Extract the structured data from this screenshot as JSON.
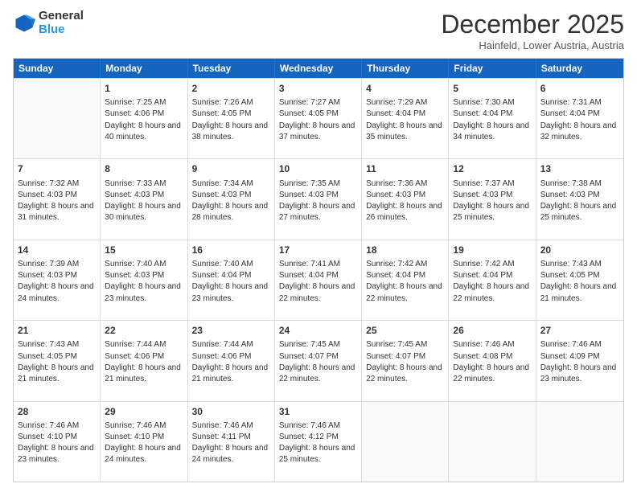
{
  "logo": {
    "general": "General",
    "blue": "Blue"
  },
  "header": {
    "month": "December 2025",
    "location": "Hainfeld, Lower Austria, Austria"
  },
  "weekdays": [
    "Sunday",
    "Monday",
    "Tuesday",
    "Wednesday",
    "Thursday",
    "Friday",
    "Saturday"
  ],
  "weeks": [
    [
      {
        "day": "",
        "empty": true
      },
      {
        "day": "1",
        "sunrise": "Sunrise: 7:25 AM",
        "sunset": "Sunset: 4:06 PM",
        "daylight": "Daylight: 8 hours and 40 minutes."
      },
      {
        "day": "2",
        "sunrise": "Sunrise: 7:26 AM",
        "sunset": "Sunset: 4:05 PM",
        "daylight": "Daylight: 8 hours and 38 minutes."
      },
      {
        "day": "3",
        "sunrise": "Sunrise: 7:27 AM",
        "sunset": "Sunset: 4:05 PM",
        "daylight": "Daylight: 8 hours and 37 minutes."
      },
      {
        "day": "4",
        "sunrise": "Sunrise: 7:29 AM",
        "sunset": "Sunset: 4:04 PM",
        "daylight": "Daylight: 8 hours and 35 minutes."
      },
      {
        "day": "5",
        "sunrise": "Sunrise: 7:30 AM",
        "sunset": "Sunset: 4:04 PM",
        "daylight": "Daylight: 8 hours and 34 minutes."
      },
      {
        "day": "6",
        "sunrise": "Sunrise: 7:31 AM",
        "sunset": "Sunset: 4:04 PM",
        "daylight": "Daylight: 8 hours and 32 minutes."
      }
    ],
    [
      {
        "day": "7",
        "sunrise": "Sunrise: 7:32 AM",
        "sunset": "Sunset: 4:03 PM",
        "daylight": "Daylight: 8 hours and 31 minutes."
      },
      {
        "day": "8",
        "sunrise": "Sunrise: 7:33 AM",
        "sunset": "Sunset: 4:03 PM",
        "daylight": "Daylight: 8 hours and 30 minutes."
      },
      {
        "day": "9",
        "sunrise": "Sunrise: 7:34 AM",
        "sunset": "Sunset: 4:03 PM",
        "daylight": "Daylight: 8 hours and 28 minutes."
      },
      {
        "day": "10",
        "sunrise": "Sunrise: 7:35 AM",
        "sunset": "Sunset: 4:03 PM",
        "daylight": "Daylight: 8 hours and 27 minutes."
      },
      {
        "day": "11",
        "sunrise": "Sunrise: 7:36 AM",
        "sunset": "Sunset: 4:03 PM",
        "daylight": "Daylight: 8 hours and 26 minutes."
      },
      {
        "day": "12",
        "sunrise": "Sunrise: 7:37 AM",
        "sunset": "Sunset: 4:03 PM",
        "daylight": "Daylight: 8 hours and 25 minutes."
      },
      {
        "day": "13",
        "sunrise": "Sunrise: 7:38 AM",
        "sunset": "Sunset: 4:03 PM",
        "daylight": "Daylight: 8 hours and 25 minutes."
      }
    ],
    [
      {
        "day": "14",
        "sunrise": "Sunrise: 7:39 AM",
        "sunset": "Sunset: 4:03 PM",
        "daylight": "Daylight: 8 hours and 24 minutes."
      },
      {
        "day": "15",
        "sunrise": "Sunrise: 7:40 AM",
        "sunset": "Sunset: 4:03 PM",
        "daylight": "Daylight: 8 hours and 23 minutes."
      },
      {
        "day": "16",
        "sunrise": "Sunrise: 7:40 AM",
        "sunset": "Sunset: 4:04 PM",
        "daylight": "Daylight: 8 hours and 23 minutes."
      },
      {
        "day": "17",
        "sunrise": "Sunrise: 7:41 AM",
        "sunset": "Sunset: 4:04 PM",
        "daylight": "Daylight: 8 hours and 22 minutes."
      },
      {
        "day": "18",
        "sunrise": "Sunrise: 7:42 AM",
        "sunset": "Sunset: 4:04 PM",
        "daylight": "Daylight: 8 hours and 22 minutes."
      },
      {
        "day": "19",
        "sunrise": "Sunrise: 7:42 AM",
        "sunset": "Sunset: 4:04 PM",
        "daylight": "Daylight: 8 hours and 22 minutes."
      },
      {
        "day": "20",
        "sunrise": "Sunrise: 7:43 AM",
        "sunset": "Sunset: 4:05 PM",
        "daylight": "Daylight: 8 hours and 21 minutes."
      }
    ],
    [
      {
        "day": "21",
        "sunrise": "Sunrise: 7:43 AM",
        "sunset": "Sunset: 4:05 PM",
        "daylight": "Daylight: 8 hours and 21 minutes."
      },
      {
        "day": "22",
        "sunrise": "Sunrise: 7:44 AM",
        "sunset": "Sunset: 4:06 PM",
        "daylight": "Daylight: 8 hours and 21 minutes."
      },
      {
        "day": "23",
        "sunrise": "Sunrise: 7:44 AM",
        "sunset": "Sunset: 4:06 PM",
        "daylight": "Daylight: 8 hours and 21 minutes."
      },
      {
        "day": "24",
        "sunrise": "Sunrise: 7:45 AM",
        "sunset": "Sunset: 4:07 PM",
        "daylight": "Daylight: 8 hours and 22 minutes."
      },
      {
        "day": "25",
        "sunrise": "Sunrise: 7:45 AM",
        "sunset": "Sunset: 4:07 PM",
        "daylight": "Daylight: 8 hours and 22 minutes."
      },
      {
        "day": "26",
        "sunrise": "Sunrise: 7:46 AM",
        "sunset": "Sunset: 4:08 PM",
        "daylight": "Daylight: 8 hours and 22 minutes."
      },
      {
        "day": "27",
        "sunrise": "Sunrise: 7:46 AM",
        "sunset": "Sunset: 4:09 PM",
        "daylight": "Daylight: 8 hours and 23 minutes."
      }
    ],
    [
      {
        "day": "28",
        "sunrise": "Sunrise: 7:46 AM",
        "sunset": "Sunset: 4:10 PM",
        "daylight": "Daylight: 8 hours and 23 minutes."
      },
      {
        "day": "29",
        "sunrise": "Sunrise: 7:46 AM",
        "sunset": "Sunset: 4:10 PM",
        "daylight": "Daylight: 8 hours and 24 minutes."
      },
      {
        "day": "30",
        "sunrise": "Sunrise: 7:46 AM",
        "sunset": "Sunset: 4:11 PM",
        "daylight": "Daylight: 8 hours and 24 minutes."
      },
      {
        "day": "31",
        "sunrise": "Sunrise: 7:46 AM",
        "sunset": "Sunset: 4:12 PM",
        "daylight": "Daylight: 8 hours and 25 minutes."
      },
      {
        "day": "",
        "empty": true
      },
      {
        "day": "",
        "empty": true
      },
      {
        "day": "",
        "empty": true
      }
    ]
  ]
}
